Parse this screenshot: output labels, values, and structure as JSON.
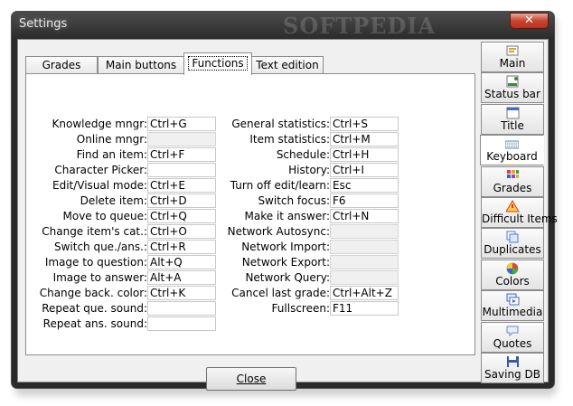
{
  "window": {
    "title": "Settings",
    "watermark": "SOFTPEDIA",
    "close_glyph": "✕"
  },
  "tabs": [
    {
      "label": "Grades",
      "active": false
    },
    {
      "label": "Main buttons",
      "active": false
    },
    {
      "label": "Functions",
      "active": true
    },
    {
      "label": "Text edition",
      "active": false
    }
  ],
  "left_column": [
    {
      "label": "Knowledge mngr:",
      "value": "Ctrl+G",
      "enabled": true
    },
    {
      "label": "Online mngr:",
      "value": "",
      "enabled": false
    },
    {
      "label": "Find an item:",
      "value": "Ctrl+F",
      "enabled": true
    },
    {
      "label": "Character Picker:",
      "value": "",
      "enabled": true
    },
    {
      "label": "Edit/Visual mode:",
      "value": "Ctrl+E",
      "enabled": true
    },
    {
      "label": "Delete item:",
      "value": "Ctrl+D",
      "enabled": true
    },
    {
      "label": "Move to queue:",
      "value": "Ctrl+Q",
      "enabled": true
    },
    {
      "label": "Change item's cat.:",
      "value": "Ctrl+O",
      "enabled": true
    },
    {
      "label": "Switch que./ans.:",
      "value": "Ctrl+R",
      "enabled": true
    },
    {
      "label": "Image to question:",
      "value": "Alt+Q",
      "enabled": true
    },
    {
      "label": "Image to answer:",
      "value": "Alt+A",
      "enabled": true
    },
    {
      "label": "Change back. color:",
      "value": "Ctrl+K",
      "enabled": true
    },
    {
      "label": "Repeat que. sound:",
      "value": "",
      "enabled": true
    },
    {
      "label": "Repeat ans. sound:",
      "value": "",
      "enabled": true
    }
  ],
  "right_column": [
    {
      "label": "General statistics:",
      "value": "Ctrl+S",
      "enabled": true
    },
    {
      "label": "Item statistics:",
      "value": "Ctrl+M",
      "enabled": true
    },
    {
      "label": "Schedule:",
      "value": "Ctrl+H",
      "enabled": true
    },
    {
      "label": "History:",
      "value": "Ctrl+I",
      "enabled": true
    },
    {
      "label": "Turn off edit/learn:",
      "value": "Esc",
      "enabled": true
    },
    {
      "label": "Switch focus:",
      "value": "F6",
      "enabled": true
    },
    {
      "label": "Make it answer:",
      "value": "Ctrl+N",
      "enabled": true
    },
    {
      "label": "Network Autosync:",
      "value": "",
      "enabled": false
    },
    {
      "label": "Network Import:",
      "value": "",
      "enabled": false
    },
    {
      "label": "Network Export:",
      "value": "",
      "enabled": false
    },
    {
      "label": "Network Query:",
      "value": "",
      "enabled": false
    },
    {
      "label": "Cancel last grade:",
      "value": "Ctrl+Alt+Z",
      "enabled": true
    },
    {
      "label": "Fullscreen:",
      "value": "F11",
      "enabled": true
    }
  ],
  "close_button": {
    "label": "Close"
  },
  "sidebar": [
    {
      "label": "Main",
      "icon": "main-icon",
      "active": false,
      "color": "#d9a13b"
    },
    {
      "label": "Status bar",
      "icon": "status-bar-icon",
      "active": false,
      "color": "#3a8a3a"
    },
    {
      "label": "Title",
      "icon": "title-icon",
      "active": false,
      "color": "#3b6fc0"
    },
    {
      "label": "Keyboard",
      "icon": "keyboard-icon",
      "active": true,
      "color": "#7a8aa0"
    },
    {
      "label": "Grades",
      "icon": "grades-icon",
      "active": false,
      "color": "#c83a3a"
    },
    {
      "label": "Difficult Items",
      "icon": "difficult-items-icon",
      "active": false,
      "color": "#d04030"
    },
    {
      "label": "Duplicates",
      "icon": "duplicates-icon",
      "active": false,
      "color": "#4a7ac8"
    },
    {
      "label": "Colors",
      "icon": "colors-icon",
      "active": false,
      "color": "#e04080"
    },
    {
      "label": "Multimedia",
      "icon": "multimedia-icon",
      "active": false,
      "color": "#4a6ac0"
    },
    {
      "label": "Quotes",
      "icon": "quotes-icon",
      "active": false,
      "color": "#6a8ad0"
    },
    {
      "label": "Saving DB",
      "icon": "save-icon",
      "active": false,
      "color": "#3a5aa0"
    }
  ]
}
